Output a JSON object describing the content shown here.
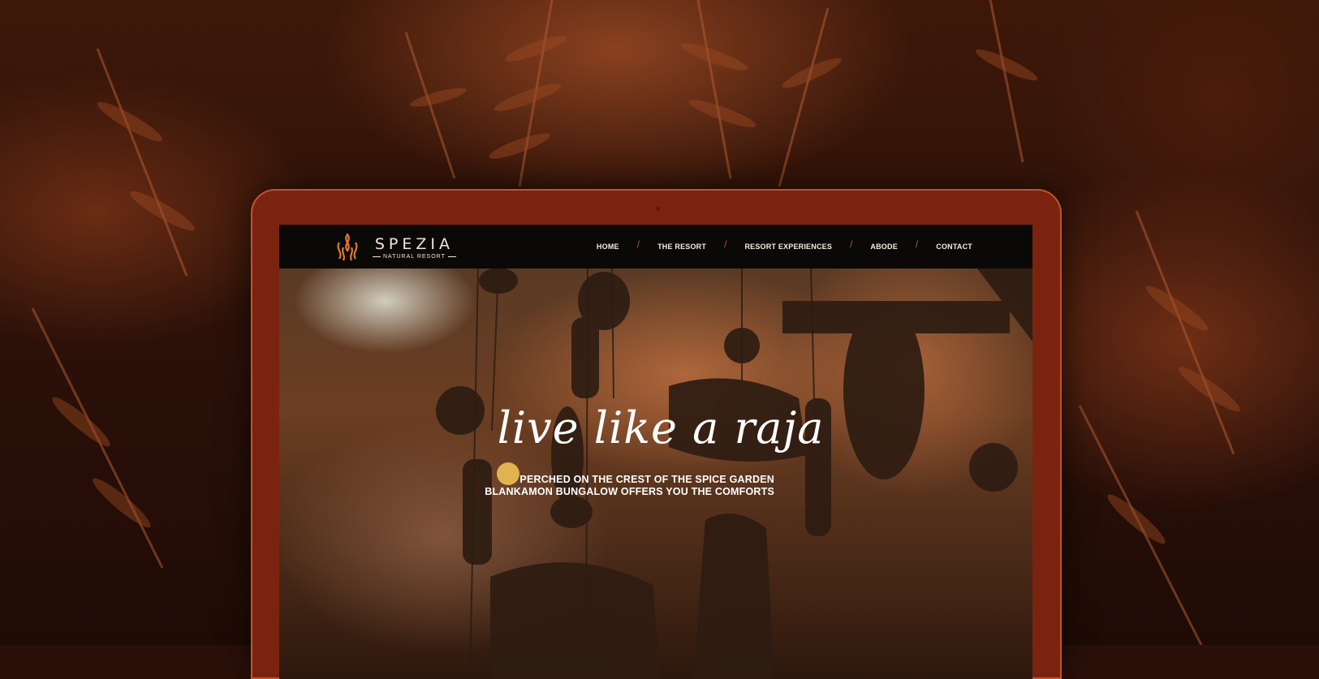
{
  "brand": {
    "name": "SPEZIA",
    "tagline": "NATURAL RESORT",
    "accent": "#e07a2e"
  },
  "nav": {
    "items": [
      {
        "label": "HOME"
      },
      {
        "label": "THE RESORT"
      },
      {
        "label": "RESORT EXPERIENCES"
      },
      {
        "label": "ABODE"
      },
      {
        "label": "CONTACT"
      }
    ],
    "separator": "/"
  },
  "hero": {
    "title": "live like a raja",
    "subtitle_line1": "PERCHED ON THE CREST OF THE SPICE GARDEN",
    "subtitle_line2": "BLANKAMON BUNGALOW OFFERS YOU THE COMFORTS"
  },
  "colors": {
    "frame": "#7a2410",
    "navbar": "#0b0908",
    "separator": "#c0532f"
  }
}
